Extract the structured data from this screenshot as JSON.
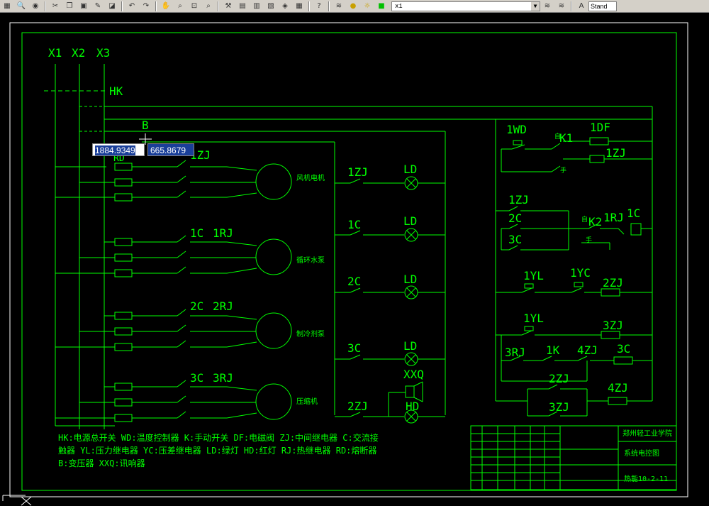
{
  "toolbar": {
    "layer_value": "xi",
    "style_value": "Stand"
  },
  "dynamic_input": {
    "x": "1884.9349",
    "y": "665.8679"
  },
  "terminals": [
    "X1",
    "X2",
    "X3"
  ],
  "switch_label": "HK",
  "transformer_label": "B",
  "fuse_label": "RD",
  "motor_section": {
    "contactor_labels": [
      "1ZJ",
      "1C",
      "1RJ",
      "2C",
      "2RJ",
      "3C",
      "3RJ"
    ],
    "motors": [
      "风机电机",
      "循环水泵",
      "制冷剂泵",
      "压缩机"
    ]
  },
  "lamp_panel": {
    "relay_labels": [
      "1ZJ",
      "1C",
      "2C",
      "3C",
      "2ZJ"
    ],
    "lamp_labels": [
      "LD",
      "LD",
      "LD",
      "LD",
      "HD"
    ],
    "buzzer_label": "XXQ"
  },
  "control_panel": {
    "labels": [
      "1WD",
      "K1",
      "1DF",
      "1ZJ",
      "1ZJ",
      "2C",
      "3C",
      "K2",
      "1RJ",
      "1C",
      "1YL",
      "1YC",
      "2ZJ",
      "1YL",
      "3ZJ",
      "3RJ",
      "1K",
      "4ZJ",
      "3C",
      "2ZJ",
      "3ZJ",
      "4ZJ"
    ],
    "small_labels": [
      "自",
      "手",
      "自",
      "手"
    ]
  },
  "legend": {
    "lines": [
      "HK:电源总开关  WD:温度控制器  K:手动开关  DF:电磁阀  ZJ:中间继电器  C:交流接",
      "触器  YL:压力继电器  YC:压差继电器  LD:绿灯  HD:红灯  RJ:热继电器  RD:熔断器",
      "B:变压器  XXQ:讯响器"
    ]
  },
  "title_block": {
    "school": "郑州轻工业学院",
    "drawing_title": "系统电控图",
    "drawing_number": "热能10-2-11"
  },
  "colors": {
    "background": "#000000",
    "line": "#00ff00",
    "toolbar": "#d4d0c8",
    "dynamic_input_selected": "#1a3f9a"
  }
}
